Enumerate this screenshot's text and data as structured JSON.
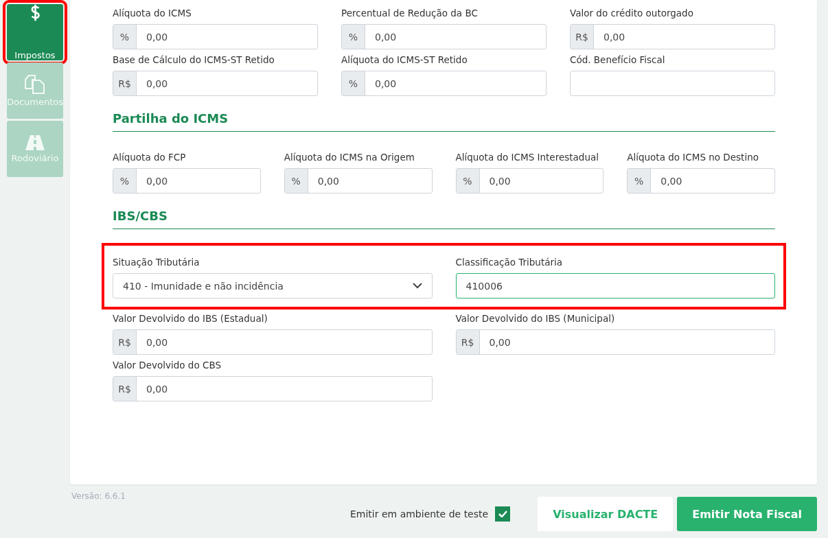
{
  "sidebar": {
    "items": [
      {
        "label": "Impostos",
        "kind": "dollar",
        "selected": true,
        "highlighted": true
      },
      {
        "label": "Documentos",
        "kind": "documents",
        "selected": false,
        "highlighted": false
      },
      {
        "label": "Rodoviário",
        "kind": "road",
        "selected": false,
        "highlighted": false
      }
    ]
  },
  "sections": [
    {
      "rows": [
        {
          "highlighted": false,
          "fields": [
            {
              "label": "Alíquota do ICMS",
              "kind": "input",
              "prefix": "%",
              "value": "0,00"
            },
            {
              "label": "Percentual de Redução da BC",
              "kind": "input",
              "prefix": "%",
              "value": "0,00"
            },
            {
              "label": "Valor do crédito outorgado",
              "kind": "input",
              "prefix": "R$",
              "value": "0,00"
            }
          ]
        },
        {
          "highlighted": false,
          "fields": [
            {
              "label": "Base de Cálculo do ICMS-ST Retido",
              "kind": "input",
              "prefix": "R$",
              "value": "0,00"
            },
            {
              "label": "Alíquota do ICMS-ST Retido",
              "kind": "input",
              "prefix": "%",
              "value": "0,00"
            },
            {
              "label": "Cód. Benefício Fiscal",
              "kind": "input"
            }
          ]
        }
      ]
    },
    {
      "title": "Partilha do ICMS",
      "rows": [
        {
          "highlighted": false,
          "fields": [
            {
              "label": "Alíquota do FCP",
              "kind": "input",
              "prefix": "%",
              "value": "0,00"
            },
            {
              "label": "Alíquota do ICMS na Origem",
              "kind": "input",
              "prefix": "%",
              "value": "0,00"
            },
            {
              "label": "Alíquota do ICMS Interestadual",
              "kind": "input",
              "prefix": "%",
              "value": "0,00"
            },
            {
              "label": "Alíquota do ICMS no Destino",
              "kind": "input",
              "prefix": "%",
              "value": "0,00"
            }
          ]
        }
      ]
    },
    {
      "title": "IBS/CBS",
      "rows": [
        {
          "highlighted": true,
          "fields": [
            {
              "label": "Situação Tributária",
              "kind": "select",
              "value": "410 - Imunidade e não incidência"
            },
            {
              "label": "Classificação Tributária",
              "kind": "input",
              "value": "410006",
              "focused": true
            }
          ]
        },
        {
          "highlighted": false,
          "fields": [
            {
              "label": "Valor Devolvido do IBS (Estadual)",
              "kind": "input",
              "prefix": "R$",
              "value": "0,00"
            },
            {
              "label": "Valor Devolvido do IBS (Municipal)",
              "kind": "input",
              "prefix": "R$",
              "value": "0,00"
            }
          ]
        },
        {
          "highlighted": false,
          "fields": [
            {
              "label": "Valor Devolvido do CBS",
              "kind": "input",
              "prefix": "R$",
              "value": "0,00"
            }
          ]
        }
      ]
    }
  ],
  "footer": {
    "version": "Versão: 6.6.1",
    "test_environment": {
      "label": "Emitir em ambiente de teste",
      "checked": true
    },
    "buttons": [
      {
        "label": "Visualizar DACTE",
        "kind": "secondary"
      },
      {
        "label": "Emitir Nota Fiscal",
        "kind": "primary"
      }
    ]
  }
}
